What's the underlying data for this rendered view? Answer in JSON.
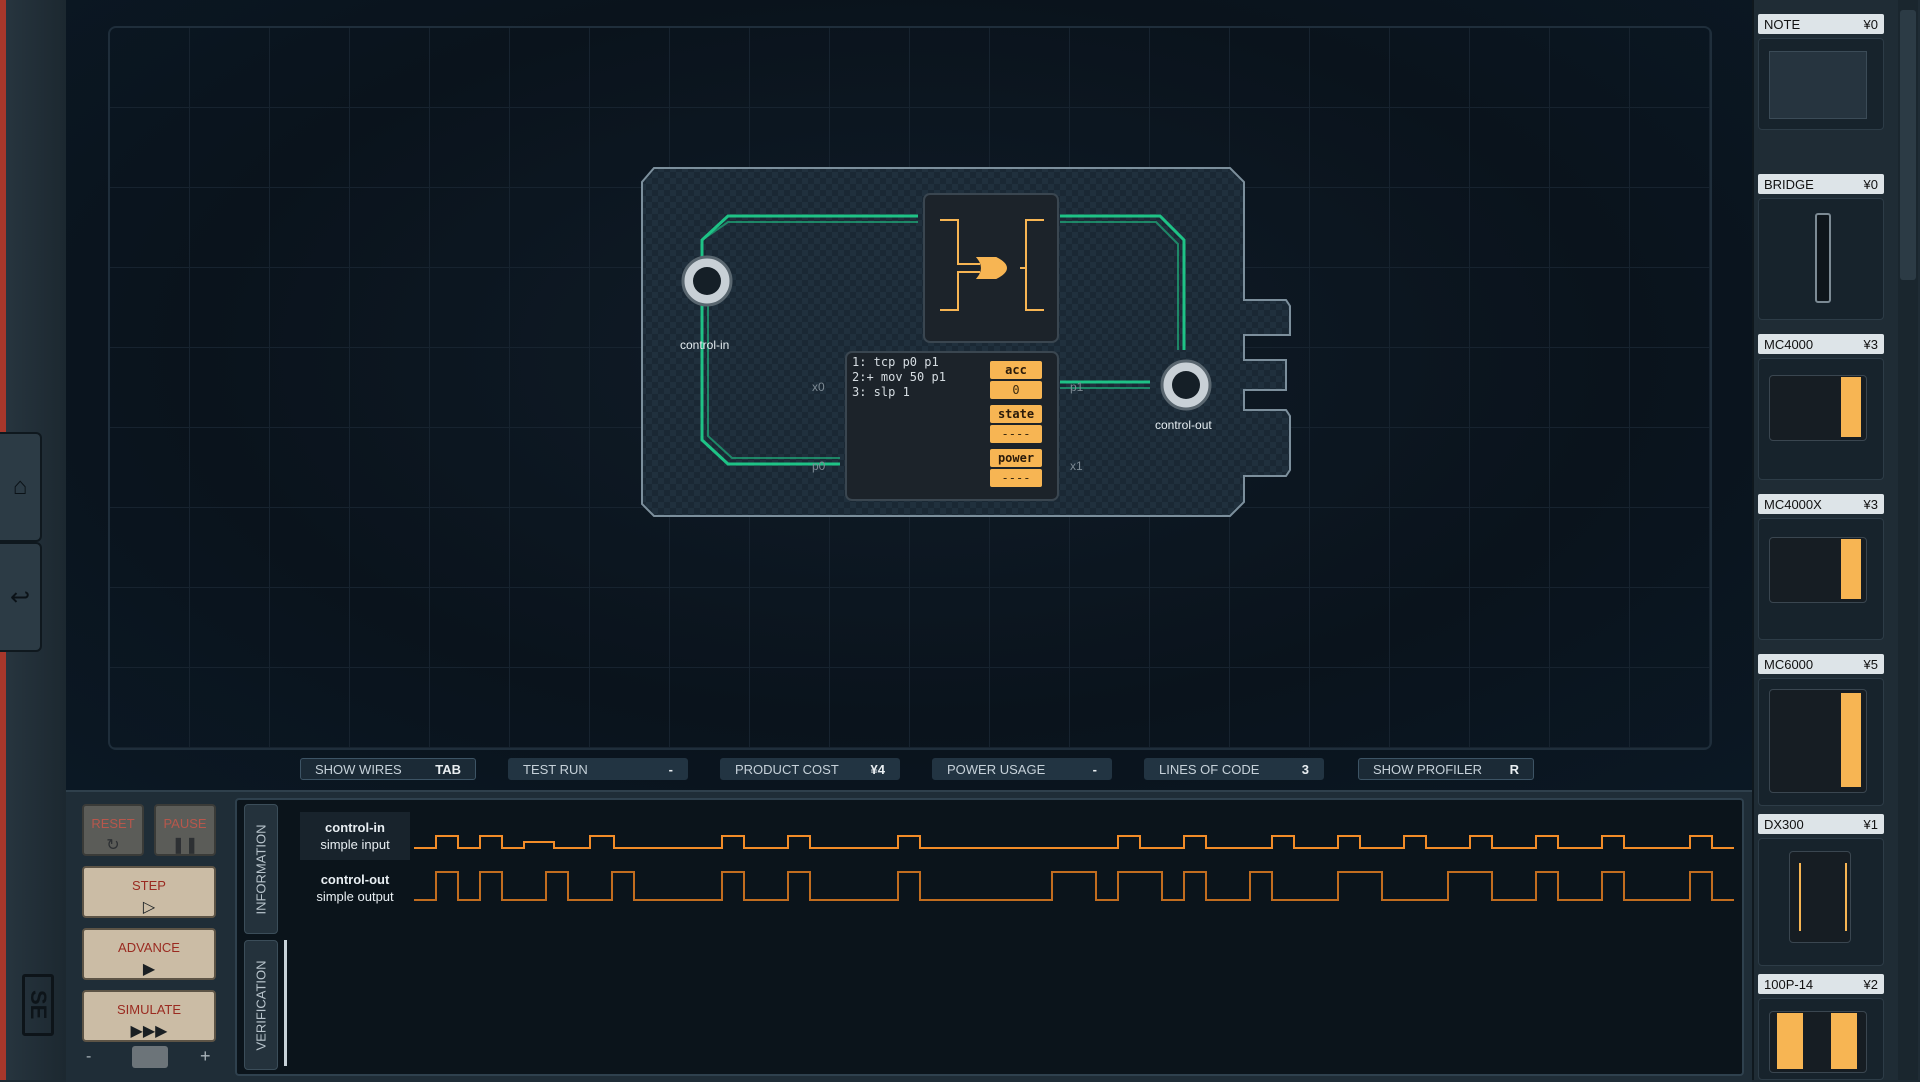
{
  "nav": {
    "home_icon": "home-icon",
    "undo_icon": "undo-icon",
    "logo": "SE"
  },
  "board": {
    "input_label": "control-in",
    "output_label": "control-out",
    "pins": {
      "x0": "x0",
      "p0": "p0",
      "p1": "p1",
      "x1": "x1"
    },
    "code": [
      "1:  tcp p0 p1",
      "2:+ mov 50 p1",
      "3:  slp 1"
    ],
    "registers": [
      {
        "name": "acc",
        "value": "0"
      },
      {
        "name": "state",
        "value": "----"
      },
      {
        "name": "power",
        "value": "----"
      }
    ],
    "colors": {
      "wire": "#1fd38f",
      "register": "#f7b553"
    }
  },
  "toolbar": {
    "show_wires": {
      "label": "SHOW WIRES",
      "key": "TAB"
    },
    "test_run": {
      "label": "TEST RUN",
      "key": "-"
    },
    "product_cost": {
      "label": "PRODUCT COST",
      "value": "¥4"
    },
    "power_usage": {
      "label": "POWER USAGE",
      "value": "-"
    },
    "lines_of_code": {
      "label": "LINES OF CODE",
      "value": "3"
    },
    "show_profiler": {
      "label": "SHOW PROFILER",
      "key": "R"
    }
  },
  "controls": {
    "reset": "RESET",
    "pause": "PAUSE",
    "step": "STEP",
    "advance": "ADVANCE",
    "simulate": "SIMULATE",
    "minus": "-",
    "plus": "+"
  },
  "tabs": {
    "information": "INFORMATION",
    "verification": "VERIFICATION"
  },
  "signals": [
    {
      "name": "control-in",
      "type": "simple input"
    },
    {
      "name": "control-out",
      "type": "simple output"
    }
  ],
  "parts": [
    {
      "name": "NOTE",
      "cost": "¥0"
    },
    {
      "name": "BRIDGE",
      "cost": "¥0"
    },
    {
      "name": "MC4000",
      "cost": "¥3"
    },
    {
      "name": "MC4000X",
      "cost": "¥3"
    },
    {
      "name": "MC6000",
      "cost": "¥5"
    },
    {
      "name": "DX300",
      "cost": "¥1"
    },
    {
      "name": "100P-14",
      "cost": "¥2"
    }
  ]
}
